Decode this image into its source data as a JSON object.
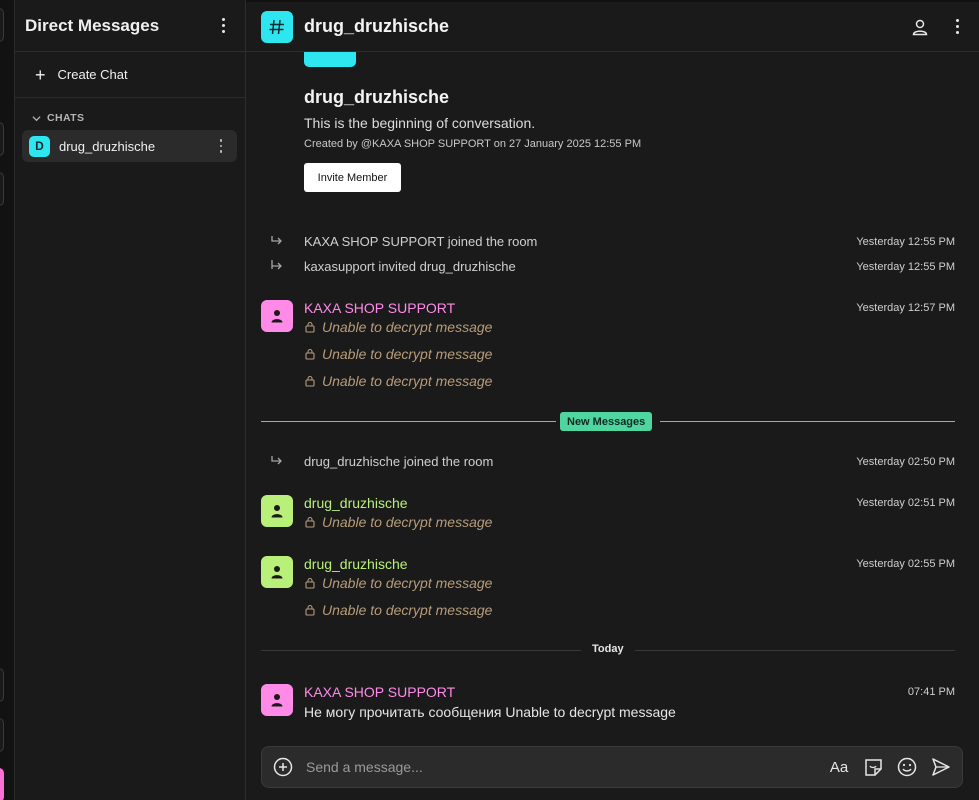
{
  "sidebar": {
    "title": "Direct Messages",
    "create_chat_label": "Create Chat",
    "section_label": "CHATS",
    "rooms": [
      {
        "initial": "D",
        "name": "drug_druzhische"
      }
    ]
  },
  "header": {
    "room_name": "drug_druzhische"
  },
  "intro": {
    "name": "drug_druzhische",
    "description": "This is the beginning of conversation.",
    "created_prefix": "Created by",
    "created_by": "@KAXA SHOP SUPPORT",
    "created_suffix": "on 27 January 2025 12:55 PM",
    "invite_label": "Invite Member"
  },
  "events": [
    {
      "text": "KAXA SHOP SUPPORT joined the room",
      "time": "Yesterday 12:55 PM"
    },
    {
      "text": "kaxasupport invited drug_druzhische",
      "time": "Yesterday 12:55 PM"
    },
    {
      "text": "drug_druzhische joined the room",
      "time": "Yesterday 02:50 PM"
    }
  ],
  "messages": [
    {
      "sender": "KAXA SHOP SUPPORT",
      "time": "Yesterday 12:57 PM",
      "lines": [
        "Unable to decrypt message",
        "Unable to decrypt message",
        "Unable to decrypt message"
      ]
    },
    {
      "sender": "drug_druzhische",
      "time": "Yesterday 02:51 PM",
      "lines": [
        "Unable to decrypt message"
      ]
    },
    {
      "sender": "drug_druzhische",
      "time": "Yesterday 02:55 PM",
      "lines": [
        "Unable to decrypt message",
        "Unable to decrypt message"
      ]
    },
    {
      "sender": "KAXA SHOP SUPPORT",
      "time": "07:41 PM",
      "text": "Не могу прочитать сообщения  Unable to decrypt message"
    }
  ],
  "dividers": {
    "new_messages": "New Messages",
    "today": "Today"
  },
  "composer": {
    "placeholder": "Send a message...",
    "format_label": "Aa"
  },
  "colors": {
    "accent_cyan": "#2ee6f0",
    "support_pink": "#ff8ae8",
    "user_green": "#b8f07a",
    "new_messages_green": "#4fd6a0",
    "decrypt_text": "#b89c7a"
  }
}
